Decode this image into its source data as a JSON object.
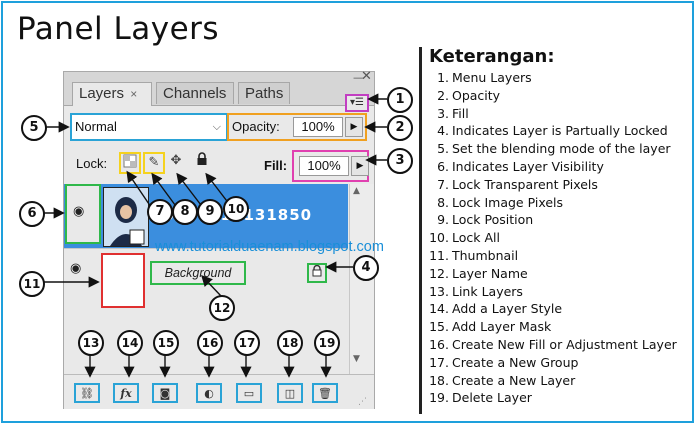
{
  "title": "Panel Layers",
  "legend": {
    "title": "Keterangan:",
    "items": [
      {
        "num": "1.",
        "text": "Menu Layers"
      },
      {
        "num": "2.",
        "text": "Opacity"
      },
      {
        "num": "3.",
        "text": "Fill"
      },
      {
        "num": "4.",
        "text": "Indicates Layer is Partually Locked"
      },
      {
        "num": "5.",
        "text": "Set the blending mode of the layer"
      },
      {
        "num": "6.",
        "text": "Indicates Layer Visibility"
      },
      {
        "num": "7.",
        "text": "Lock Transparent Pixels"
      },
      {
        "num": "8.",
        "text": "Lock Image Pixels"
      },
      {
        "num": "9.",
        "text": "Lock Position"
      },
      {
        "num": "10.",
        "text": "Lock All"
      },
      {
        "num": "11.",
        "text": "Thumbnail"
      },
      {
        "num": "12.",
        "text": "Layer Name"
      },
      {
        "num": "13.",
        "text": "Link Layers"
      },
      {
        "num": "14.",
        "text": "Add a Layer Style"
      },
      {
        "num": "15.",
        "text": "Add Layer Mask"
      },
      {
        "num": "16.",
        "text": "Create New Fill or Adjustment Layer"
      },
      {
        "num": "17.",
        "text": "Create a New Group"
      },
      {
        "num": "18.",
        "text": "Create a New Layer"
      },
      {
        "num": "19.",
        "text": "Delete Layer"
      }
    ]
  },
  "panel": {
    "tabs": [
      {
        "label": "Layers",
        "close": "×"
      },
      {
        "label": "Channels"
      },
      {
        "label": "Paths"
      }
    ],
    "window_min": "—",
    "window_close": "✕",
    "menu_icon": "▾☰",
    "blend_mode": "Normal",
    "blend_chevron": "⌵",
    "opacity_label": "Opacity:",
    "opacity_value": "100%",
    "arrow": "▶",
    "lock_label": "Lock:",
    "fill_label": "Fill:",
    "fill_value": "100%",
    "lock_icons": [
      "checker-icon",
      "brush-icon",
      "move-icon",
      "lock-icon"
    ],
    "layers": [
      {
        "name": "20170215131850",
        "selected": true,
        "visible": true
      },
      {
        "name": "Background",
        "selected": false,
        "visible": true,
        "locked": true
      }
    ],
    "bottom_buttons": [
      "link-icon",
      "fx-icon",
      "mask-icon",
      "adjustment-icon",
      "folder-icon",
      "new-layer-icon",
      "trash-icon"
    ]
  },
  "watermark": "www.tutorialduaenam.blogspot.com",
  "callouts": [
    "1",
    "2",
    "3",
    "4",
    "5",
    "6",
    "7",
    "8",
    "9",
    "10",
    "11",
    "12",
    "13",
    "14",
    "15",
    "16",
    "17",
    "18",
    "19"
  ],
  "colors": {
    "frame": "#1ea0dc",
    "selected_layer": "#3b8ede",
    "watermark": "#1a8fd8"
  }
}
